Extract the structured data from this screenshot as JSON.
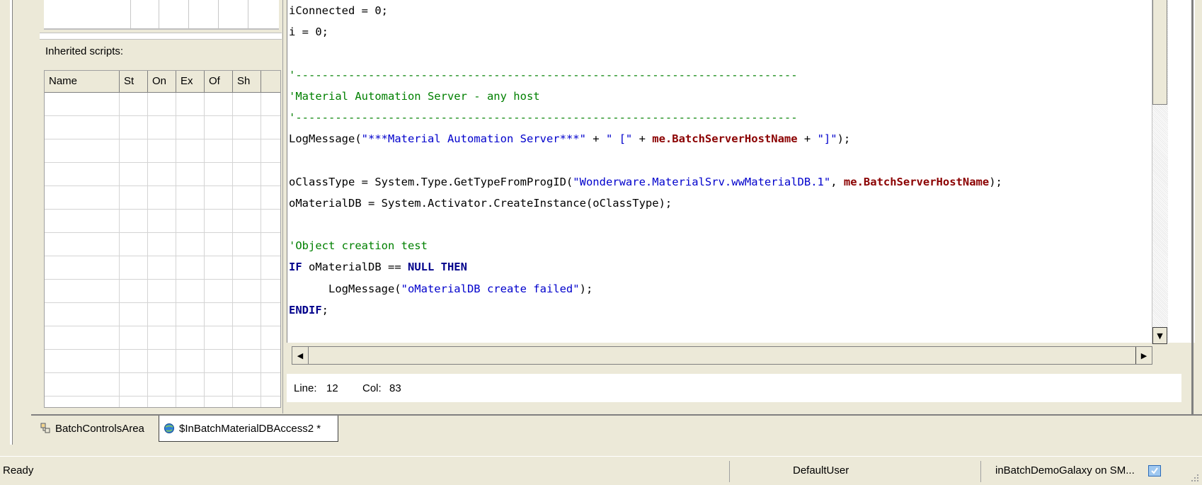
{
  "left_panel": {
    "inherited_label": "Inherited scripts:",
    "columns": [
      "Name",
      "St",
      "On",
      "Ex",
      "Of",
      "Sh"
    ]
  },
  "code_lines": [
    [
      {
        "t": "iConnected = 0;",
        "c": ""
      }
    ],
    [
      {
        "t": "i = 0;",
        "c": ""
      }
    ],
    [
      {
        "t": "",
        "c": ""
      }
    ],
    [
      {
        "t": "'----------------------------------------------------------------------------",
        "c": "cmt"
      }
    ],
    [
      {
        "t": "'Material Automation Server - any host",
        "c": "cmt"
      }
    ],
    [
      {
        "t": "'----------------------------------------------------------------------------",
        "c": "cmt"
      }
    ],
    [
      {
        "t": "LogMessage(",
        "c": ""
      },
      {
        "t": "\"***Material Automation Server***\"",
        "c": "str"
      },
      {
        "t": " + ",
        "c": ""
      },
      {
        "t": "\" [\"",
        "c": "str"
      },
      {
        "t": " + ",
        "c": ""
      },
      {
        "t": "me.BatchServerHostName",
        "c": "kw-red"
      },
      {
        "t": " + ",
        "c": ""
      },
      {
        "t": "\"]\"",
        "c": "str"
      },
      {
        "t": ");",
        "c": ""
      }
    ],
    [
      {
        "t": "",
        "c": ""
      }
    ],
    [
      {
        "t": "oClassType = System.Type.GetTypeFromProgID(",
        "c": ""
      },
      {
        "t": "\"Wonderware.MaterialSrv.wwMaterialDB.1\"",
        "c": "str"
      },
      {
        "t": ", ",
        "c": ""
      },
      {
        "t": "me.BatchServerHostName",
        "c": "kw-red"
      },
      {
        "t": ");",
        "c": ""
      }
    ],
    [
      {
        "t": "oMaterialDB = System.Activator.CreateInstance(oClassType);",
        "c": ""
      }
    ],
    [
      {
        "t": "",
        "c": ""
      }
    ],
    [
      {
        "t": "'Object creation test",
        "c": "cmt"
      }
    ],
    [
      {
        "t": "IF",
        "c": "kw-blue"
      },
      {
        "t": " oMaterialDB == ",
        "c": ""
      },
      {
        "t": "NULL THEN",
        "c": "kw-blue"
      }
    ],
    [
      {
        "t": "      LogMessage(",
        "c": ""
      },
      {
        "t": "\"oMaterialDB create failed\"",
        "c": "str"
      },
      {
        "t": ");",
        "c": ""
      }
    ],
    [
      {
        "t": "ENDIF",
        "c": "kw-blue"
      },
      {
        "t": ";",
        "c": ""
      }
    ]
  ],
  "cursor": {
    "line_label": "Line:",
    "line": "12",
    "col_label": "Col:",
    "col": "83"
  },
  "tabs": [
    {
      "label": "BatchControlsArea",
      "icon": "area-icon",
      "active": false
    },
    {
      "label": "$InBatchMaterialDBAccess2 *",
      "icon": "template-globe-icon",
      "active": true
    }
  ],
  "status": {
    "ready": "Ready",
    "user": "DefaultUser",
    "galaxy": "inBatchDemoGalaxy on SM..."
  },
  "colors": {
    "comment": "#008000",
    "string": "#0000cc",
    "keyword": "#00008b",
    "member": "#8b0000"
  }
}
